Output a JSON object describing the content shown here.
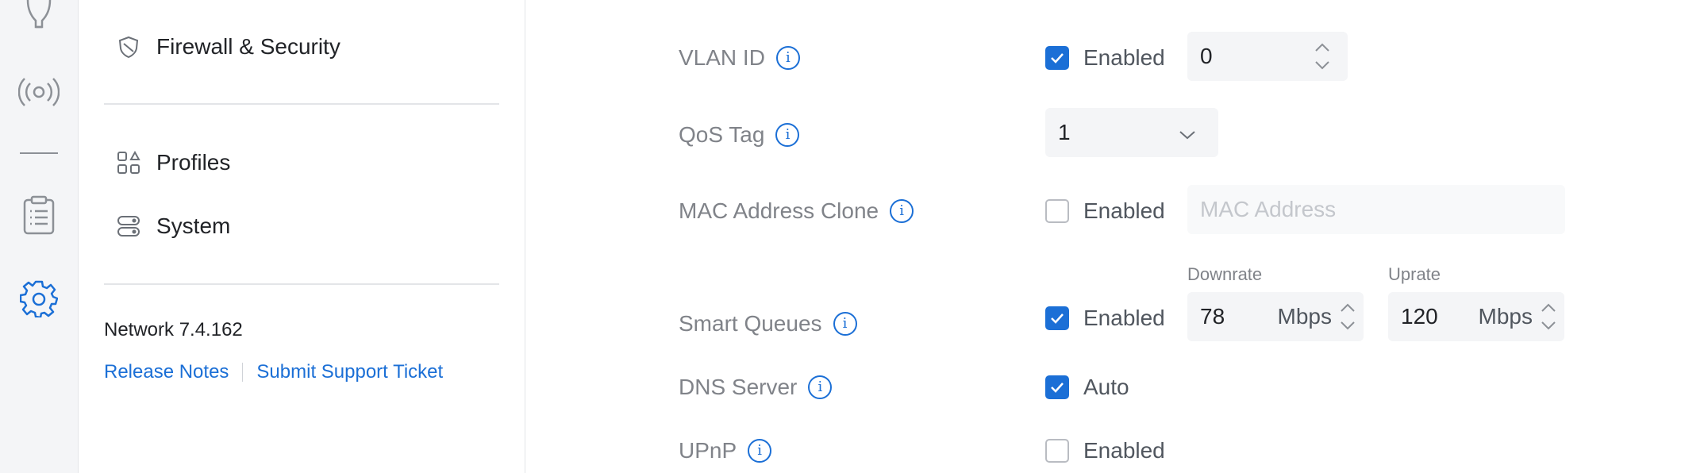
{
  "sidebar": {
    "items": [
      {
        "label": "Firewall & Security",
        "icon": "shield-icon"
      },
      {
        "label": "Profiles",
        "icon": "grid-shapes-icon"
      },
      {
        "label": "System",
        "icon": "toggles-icon"
      }
    ],
    "version": "Network 7.4.162",
    "links": {
      "release_notes": "Release Notes",
      "support": "Submit Support Ticket"
    }
  },
  "rail": {
    "icons": [
      "lightbulb-icon",
      "wireless-icon",
      "divider",
      "clipboard-icon",
      "gear-icon"
    ]
  },
  "form": {
    "vlan": {
      "label": "VLAN ID",
      "checkbox_label": "Enabled",
      "checked": true,
      "value": "0"
    },
    "qos": {
      "label": "QoS Tag",
      "value": "1"
    },
    "mac": {
      "label": "MAC Address Clone",
      "checkbox_label": "Enabled",
      "checked": false,
      "placeholder": "MAC Address"
    },
    "smart_queues": {
      "label": "Smart Queues",
      "checkbox_label": "Enabled",
      "checked": true,
      "downrate": {
        "label": "Downrate",
        "value": "78",
        "unit": "Mbps"
      },
      "uprate": {
        "label": "Uprate",
        "value": "120",
        "unit": "Mbps"
      }
    },
    "dns": {
      "label": "DNS Server",
      "checkbox_label": "Auto",
      "checked": true
    },
    "upnp": {
      "label": "UPnP",
      "checkbox_label": "Enabled",
      "checked": false
    }
  },
  "colors": {
    "accent": "#1b6fd6",
    "muted_text": "#808389",
    "field_bg": "#f4f5f7"
  }
}
